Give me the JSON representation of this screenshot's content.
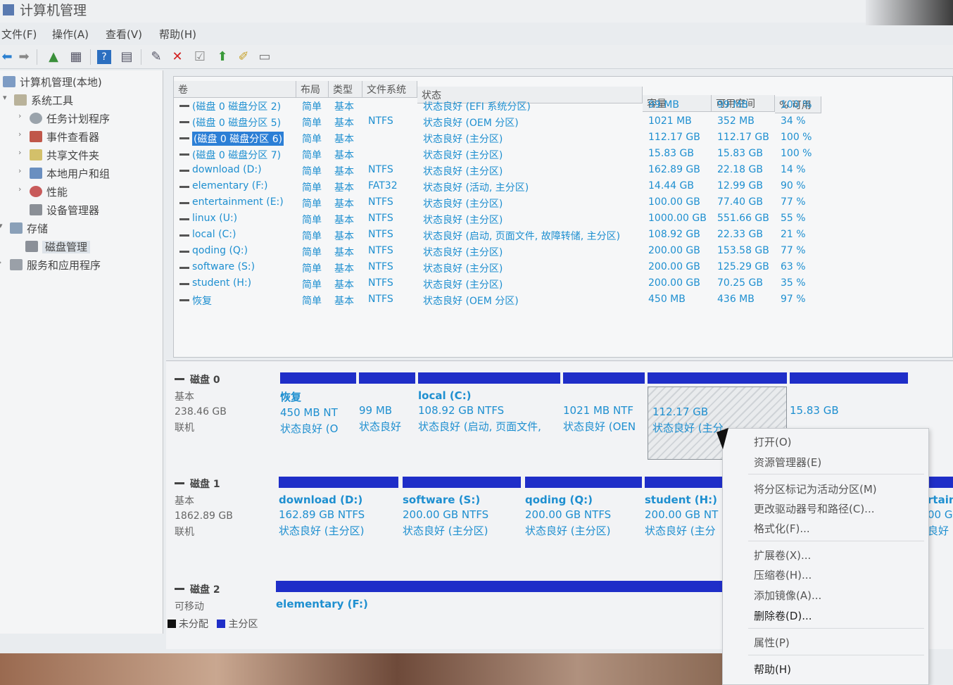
{
  "window": {
    "title": "计算机管理"
  },
  "menu": [
    "文件(F)",
    "操作(A)",
    "查看(V)",
    "帮助(H)"
  ],
  "toolbar": {
    "icons": [
      "back-icon",
      "forward-icon",
      "up-folder-icon",
      "show-hide-tree-icon",
      "help-icon",
      "properties-icon",
      "connect-icon",
      "delete-icon",
      "checklist-icon",
      "import-icon",
      "export-icon",
      "view-icon"
    ]
  },
  "tree": {
    "root": "计算机管理(本地)",
    "system_tools": "系统工具",
    "task_scheduler": "任务计划程序",
    "event_viewer": "事件查看器",
    "shared_folders": "共享文件夹",
    "local_users": "本地用户和组",
    "performance": "性能",
    "device_manager": "设备管理器",
    "storage": "存储",
    "disk_management": "磁盘管理",
    "services": "服务和应用程序"
  },
  "columns": [
    "卷",
    "布局",
    "类型",
    "文件系统",
    "状态",
    "容量",
    "可用空间",
    "% 可用"
  ],
  "volumes": [
    {
      "name": "(磁盘 0 磁盘分区 2)",
      "layout": "简单",
      "type": "基本",
      "fs": "",
      "status": "状态良好 (EFI 系统分区)",
      "capacity": "99 MB",
      "free": "99 MB",
      "pct": "100 %"
    },
    {
      "name": "(磁盘 0 磁盘分区 5)",
      "layout": "简单",
      "type": "基本",
      "fs": "NTFS",
      "status": "状态良好 (OEM 分区)",
      "capacity": "1021 MB",
      "free": "352 MB",
      "pct": "34 %"
    },
    {
      "name": "(磁盘 0 磁盘分区 6)",
      "layout": "简单",
      "type": "基本",
      "fs": "",
      "status": "状态良好 (主分区)",
      "capacity": "112.17 GB",
      "free": "112.17 GB",
      "pct": "100 %",
      "selected": true
    },
    {
      "name": "(磁盘 0 磁盘分区 7)",
      "layout": "简单",
      "type": "基本",
      "fs": "",
      "status": "状态良好 (主分区)",
      "capacity": "15.83 GB",
      "free": "15.83 GB",
      "pct": "100 %"
    },
    {
      "name": "download (D:)",
      "layout": "简单",
      "type": "基本",
      "fs": "NTFS",
      "status": "状态良好 (主分区)",
      "capacity": "162.89 GB",
      "free": "22.18 GB",
      "pct": "14 %"
    },
    {
      "name": "elementary (F:)",
      "layout": "简单",
      "type": "基本",
      "fs": "FAT32",
      "status": "状态良好 (活动, 主分区)",
      "capacity": "14.44 GB",
      "free": "12.99 GB",
      "pct": "90 %"
    },
    {
      "name": "entertainment (E:)",
      "layout": "简单",
      "type": "基本",
      "fs": "NTFS",
      "status": "状态良好 (主分区)",
      "capacity": "100.00 GB",
      "free": "77.40 GB",
      "pct": "77 %"
    },
    {
      "name": "linux (U:)",
      "layout": "简单",
      "type": "基本",
      "fs": "NTFS",
      "status": "状态良好 (主分区)",
      "capacity": "1000.00 GB",
      "free": "551.66 GB",
      "pct": "55 %"
    },
    {
      "name": "local (C:)",
      "layout": "简单",
      "type": "基本",
      "fs": "NTFS",
      "status": "状态良好 (启动, 页面文件, 故障转储, 主分区)",
      "capacity": "108.92 GB",
      "free": "22.33 GB",
      "pct": "21 %"
    },
    {
      "name": "qoding (Q:)",
      "layout": "简单",
      "type": "基本",
      "fs": "NTFS",
      "status": "状态良好 (主分区)",
      "capacity": "200.00 GB",
      "free": "153.58 GB",
      "pct": "77 %"
    },
    {
      "name": "software (S:)",
      "layout": "简单",
      "type": "基本",
      "fs": "NTFS",
      "status": "状态良好 (主分区)",
      "capacity": "200.00 GB",
      "free": "125.29 GB",
      "pct": "63 %"
    },
    {
      "name": "student (H:)",
      "layout": "简单",
      "type": "基本",
      "fs": "NTFS",
      "status": "状态良好 (主分区)",
      "capacity": "200.00 GB",
      "free": "70.25 GB",
      "pct": "35 %"
    },
    {
      "name": "恢复",
      "layout": "简单",
      "type": "基本",
      "fs": "NTFS",
      "status": "状态良好 (OEM 分区)",
      "capacity": "450 MB",
      "free": "436 MB",
      "pct": "97 %"
    }
  ],
  "disks": [
    {
      "name": "磁盘 0",
      "kind": "基本",
      "size": "238.46 GB",
      "state": "联机",
      "parts": [
        {
          "title": "恢复",
          "l1": "450 MB NT",
          "l2": "状态良好 (O"
        },
        {
          "title": "",
          "l1": "99 MB",
          "l2": "状态良好"
        },
        {
          "title": "local  (C:)",
          "l1": "108.92 GB NTFS",
          "l2": "状态良好 (启动, 页面文件,"
        },
        {
          "title": "",
          "l1": "1021 MB NTF",
          "l2": "状态良好 (OEN"
        },
        {
          "title": "",
          "l1": "112.17 GB",
          "l2": "状态良好 (主分"
        },
        {
          "title": "",
          "l1": "15.83 GB",
          "l2": ""
        }
      ]
    },
    {
      "name": "磁盘 1",
      "kind": "基本",
      "size": "1862.89 GB",
      "state": "联机",
      "parts": [
        {
          "title": "download  (D:)",
          "l1": "162.89 GB NTFS",
          "l2": "状态良好 (主分区)"
        },
        {
          "title": "software  (S:)",
          "l1": "200.00 GB NTFS",
          "l2": "状态良好 (主分区)"
        },
        {
          "title": "qoding  (Q:)",
          "l1": "200.00 GB NTFS",
          "l2": "状态良好 (主分区)"
        },
        {
          "title": "student  (H:)",
          "l1": "200.00 GB NT",
          "l2": "状态良好 (主分"
        },
        {
          "title": "rtain",
          "l1": "00 G",
          "l2": "良好"
        }
      ]
    },
    {
      "name": "磁盘 2",
      "kind": "可移动",
      "size": "",
      "state": "",
      "parts": [
        {
          "title": "elementary  (F:)",
          "l1": "",
          "l2": ""
        }
      ]
    }
  ],
  "legend": {
    "unallocated": "未分配",
    "primary": "主分区",
    "unallocated_color": "#111111",
    "primary_color": "#1f2ec8"
  },
  "context_menu": {
    "open": "打开(O)",
    "explorer": "资源管理器(E)",
    "mark_active": "将分区标记为活动分区(M)",
    "change_letter": "更改驱动器号和路径(C)...",
    "format": "格式化(F)...",
    "extend": "扩展卷(X)...",
    "shrink": "压缩卷(H)...",
    "add_mirror": "添加镜像(A)...",
    "delete": "删除卷(D)...",
    "properties": "属性(P)",
    "help": "帮助(H)"
  },
  "colors": {
    "accent": "#1e8fd0",
    "partition_bar": "#1f2ec8",
    "selection": "#2c7fd6"
  }
}
